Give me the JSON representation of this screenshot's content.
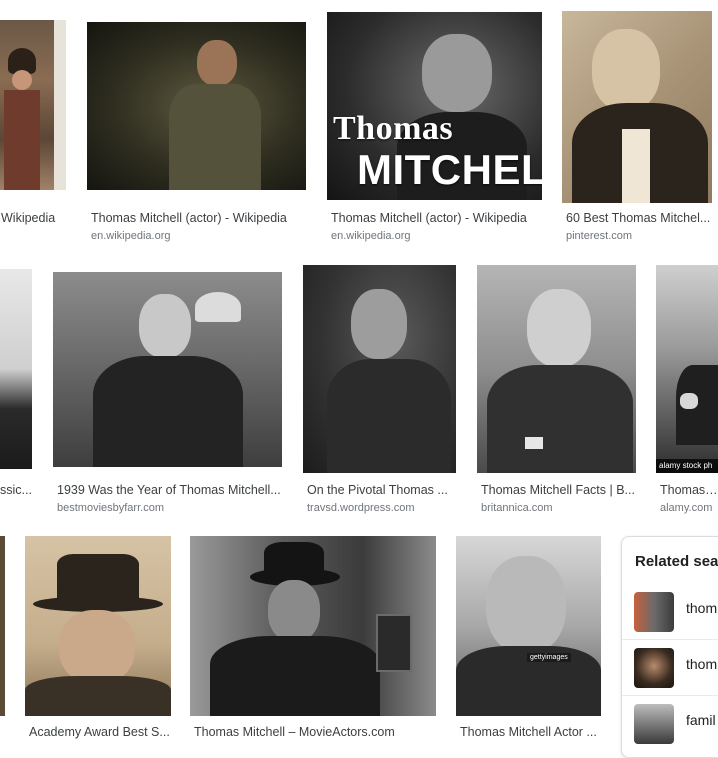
{
  "row1": [
    {
      "title": "Wikipedia",
      "source": ""
    },
    {
      "title": "Thomas Mitchell (actor) - Wikipedia",
      "source": "en.wikipedia.org"
    },
    {
      "title": "Thomas Mitchell (actor) - Wikipedia",
      "source": "en.wikipedia.org"
    },
    {
      "title": "60 Best Thomas Mitchel...",
      "source": "pinterest.com"
    }
  ],
  "row2": [
    {
      "title": "ssic...",
      "source": ""
    },
    {
      "title": "1939 Was the Year of Thomas Mitchell...",
      "source": "bestmoviesbyfarr.com"
    },
    {
      "title": "On the Pivotal Thomas ...",
      "source": "travsd.wordpress.com"
    },
    {
      "title": "Thomas Mitchell Facts | B...",
      "source": "britannica.com"
    },
    {
      "title": "Thomas M",
      "source": "alamy.com"
    }
  ],
  "row3": [
    {
      "title": "Academy Award Best S...",
      "source": ""
    },
    {
      "title": "Thomas Mitchell – MovieActors.com",
      "source": ""
    },
    {
      "title": "Thomas Mitchell Actor ...",
      "source": ""
    }
  ],
  "overlay": {
    "line1": "Thomas",
    "line2": "MITCHELL"
  },
  "alamy_badge": "alamy stock ph",
  "getty_mark": "gettyimages",
  "related": {
    "title": "Related sea",
    "items": [
      {
        "label": "thom"
      },
      {
        "label": "thom"
      },
      {
        "label": "famil"
      }
    ]
  }
}
